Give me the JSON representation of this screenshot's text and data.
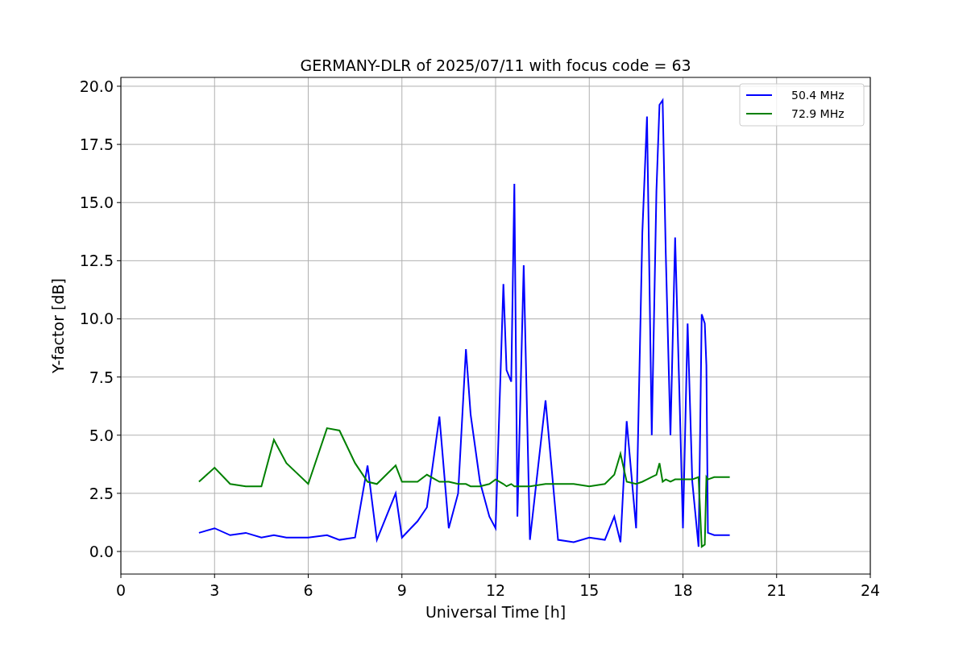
{
  "chart_data": {
    "type": "line",
    "title": "GERMANY-DLR of 2025/07/11 with focus code = 63",
    "xlabel": "Universal Time [h]",
    "ylabel": "Y-factor [dB]",
    "x": [
      2.5,
      3.0,
      3.5,
      4.0,
      4.5,
      4.9,
      5.3,
      6.0,
      6.6,
      7.0,
      7.5,
      7.9,
      8.2,
      8.8,
      9.0,
      9.5,
      9.8,
      10.2,
      10.5,
      10.8,
      11.05,
      11.2,
      11.5,
      11.8,
      12.0,
      12.25,
      12.35,
      12.5,
      12.6,
      12.7,
      12.9,
      13.1,
      13.6,
      14.0,
      14.5,
      15.0,
      15.5,
      15.8,
      16.0,
      16.2,
      16.5,
      16.7,
      16.85,
      17.0,
      17.15,
      17.25,
      17.35,
      17.45,
      17.6,
      17.75,
      17.9,
      18.0,
      18.15,
      18.3,
      18.5,
      18.6,
      18.7,
      18.75,
      18.8,
      19.0,
      19.5
    ],
    "series": [
      {
        "name": "50.4 MHz",
        "color": "#0000ff",
        "values": [
          0.8,
          1.0,
          0.7,
          0.8,
          0.6,
          0.7,
          0.6,
          0.6,
          0.7,
          0.5,
          0.6,
          3.7,
          0.5,
          2.5,
          0.6,
          1.3,
          1.9,
          5.8,
          1.0,
          2.5,
          8.7,
          5.9,
          3.0,
          1.5,
          1.0,
          11.5,
          7.8,
          7.3,
          15.8,
          1.5,
          12.3,
          0.5,
          6.5,
          0.5,
          0.4,
          0.6,
          0.5,
          1.5,
          0.4,
          5.6,
          1.0,
          13.7,
          18.7,
          5.0,
          15.5,
          19.2,
          19.4,
          12.8,
          5.0,
          13.5,
          6.2,
          1.0,
          9.8,
          3.0,
          0.2,
          10.2,
          9.8,
          8.0,
          0.8,
          0.7,
          0.7
        ]
      },
      {
        "name": "72.9 MHz",
        "color": "#008000",
        "values": [
          3.0,
          3.6,
          2.9,
          2.8,
          2.8,
          4.8,
          3.8,
          2.9,
          5.3,
          5.2,
          3.8,
          3.0,
          2.9,
          3.7,
          3.0,
          3.0,
          3.3,
          3.0,
          3.0,
          2.9,
          2.9,
          2.8,
          2.8,
          2.9,
          3.1,
          2.9,
          2.8,
          2.9,
          2.8,
          2.8,
          2.8,
          2.8,
          2.9,
          2.9,
          2.9,
          2.8,
          2.9,
          3.3,
          4.2,
          3.0,
          2.9,
          3.0,
          3.1,
          3.2,
          3.3,
          3.8,
          3.0,
          3.1,
          3.0,
          3.1,
          3.1,
          3.1,
          3.1,
          3.1,
          3.2,
          0.2,
          0.3,
          3.2,
          3.1,
          3.2,
          3.2
        ]
      }
    ],
    "grid": true,
    "legend": true,
    "xlim": [
      0,
      24
    ],
    "ylim": [
      -0.97,
      20.38
    ],
    "xticks": [
      0,
      3,
      6,
      9,
      12,
      15,
      18,
      21,
      24
    ],
    "yticks": [
      {
        "value": 0,
        "label": "0.0"
      },
      {
        "value": 2.5,
        "label": "2.5"
      },
      {
        "value": 5,
        "label": "5.0"
      },
      {
        "value": 7.5,
        "label": "7.5"
      },
      {
        "value": 10,
        "label": "10.0"
      },
      {
        "value": 12.5,
        "label": "12.5"
      },
      {
        "value": 15,
        "label": "15.0"
      },
      {
        "value": 17.5,
        "label": "17.5"
      },
      {
        "value": 20,
        "label": "20.0"
      }
    ]
  }
}
